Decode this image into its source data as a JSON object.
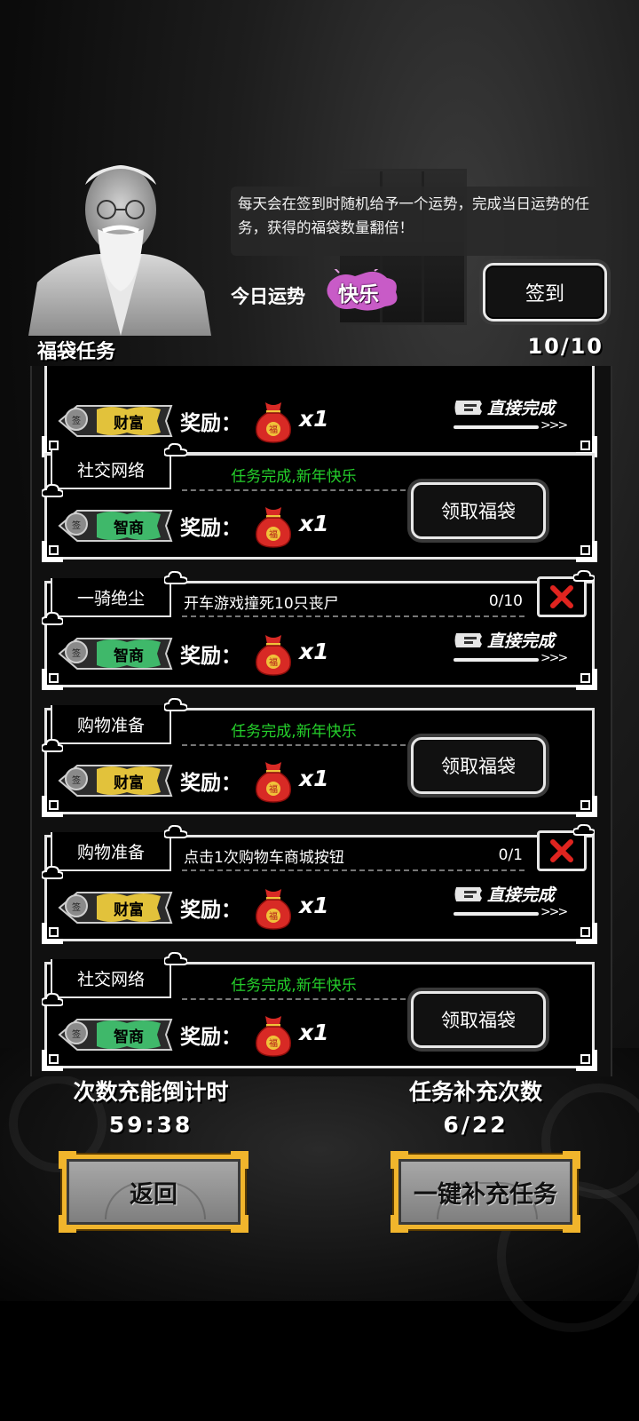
{
  "header": {
    "notice": "每天会在签到时随机给予一个运势，完成当日运势的任务，获得的福袋数量翻倍！",
    "fortune_label": "今日运势",
    "fortune_value": "快乐",
    "signin_label": "签到",
    "section_title": "福袋任务",
    "section_count": "10/10"
  },
  "tasks": [
    {
      "title": "",
      "desc": "",
      "attr": "财富",
      "attr_color": "#e2c23b",
      "reward_label": "奖励：",
      "reward_mult": "x1",
      "action": "直接完成"
    },
    {
      "title": "社交网络",
      "desc": "任务完成,新年快乐",
      "attr": "智商",
      "attr_color": "#3fb86a",
      "reward_label": "奖励：",
      "reward_mult": "x1",
      "action": "领取福袋"
    },
    {
      "title": "一骑绝尘",
      "desc": "开车游戏撞死10只丧尸",
      "progress": "0/10",
      "attr": "智商",
      "attr_color": "#3fb86a",
      "reward_label": "奖励：",
      "reward_mult": "x1",
      "action": "直接完成"
    },
    {
      "title": "购物准备",
      "desc": "任务完成,新年快乐",
      "attr": "财富",
      "attr_color": "#e2c23b",
      "reward_label": "奖励：",
      "reward_mult": "x1",
      "action": "领取福袋"
    },
    {
      "title": "购物准备",
      "desc": "点击1次购物车商城按钮",
      "progress": "0/1",
      "attr": "财富",
      "attr_color": "#e2c23b",
      "reward_label": "奖励：",
      "reward_mult": "x1",
      "action": "直接完成"
    },
    {
      "title": "社交网络",
      "desc": "任务完成,新年快乐",
      "attr": "智商",
      "attr_color": "#3fb86a",
      "reward_label": "奖励：",
      "reward_mult": "x1",
      "action": "领取福袋"
    }
  ],
  "seal_char": "签",
  "bag_char": "福",
  "stats": {
    "countdown_label": "次数充能倒计时",
    "countdown_value": "59:38",
    "refill_label": "任务补充次数",
    "refill_value": "6/22"
  },
  "buttons": {
    "back": "返回",
    "refill_all": "一键补充任务"
  },
  "colors": {
    "done_text": "#25d02b",
    "gold_border": "#f1b52c",
    "fortune_badge": "#c85bc7",
    "close_x": "#e0241f"
  }
}
